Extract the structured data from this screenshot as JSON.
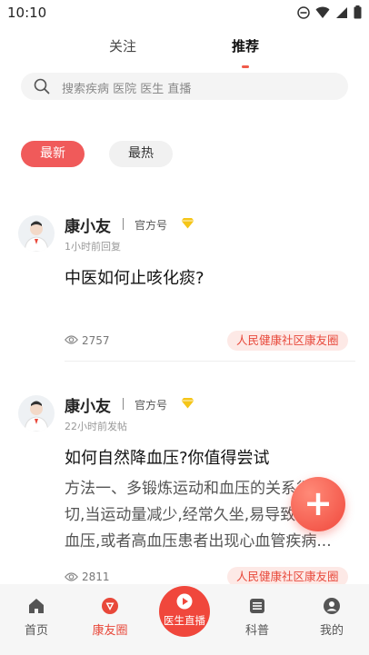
{
  "status_bar": {
    "time": "10:10"
  },
  "top_tabs": [
    {
      "label": "关注"
    },
    {
      "label": "推荐"
    }
  ],
  "search": {
    "placeholder": "搜索疾病 医院 医生 直播"
  },
  "filters": [
    {
      "label": "最新"
    },
    {
      "label": "最热"
    }
  ],
  "posts": [
    {
      "author": "康小友",
      "role": "官方号",
      "time": "1小时前回复",
      "title": "中医如何止咳化痰?",
      "body": [],
      "views": "2757",
      "tag": "人民健康社区康友圈"
    },
    {
      "author": "康小友",
      "role": "官方号",
      "time": "22小时前发帖",
      "title": "如何自然降血压?你值得尝试",
      "body": [
        "方法一、多锻炼运动和血压的关系很密",
        "切,当运动量减少,经常久坐,易导致高",
        "血压,或者高血压患者出现心血管疾病..."
      ],
      "views": "2811",
      "tag": "人民健康社区康友圈"
    }
  ],
  "fab": {
    "label": "+"
  },
  "tab_bar": [
    {
      "label": "首页"
    },
    {
      "label": "康友圈"
    },
    {
      "label": "医生直播"
    },
    {
      "label": "科普"
    },
    {
      "label": "我的"
    }
  ],
  "colors": {
    "accent": "#f05a4a",
    "tag_bg": "#fde9e6",
    "badge": "#f5c518"
  }
}
